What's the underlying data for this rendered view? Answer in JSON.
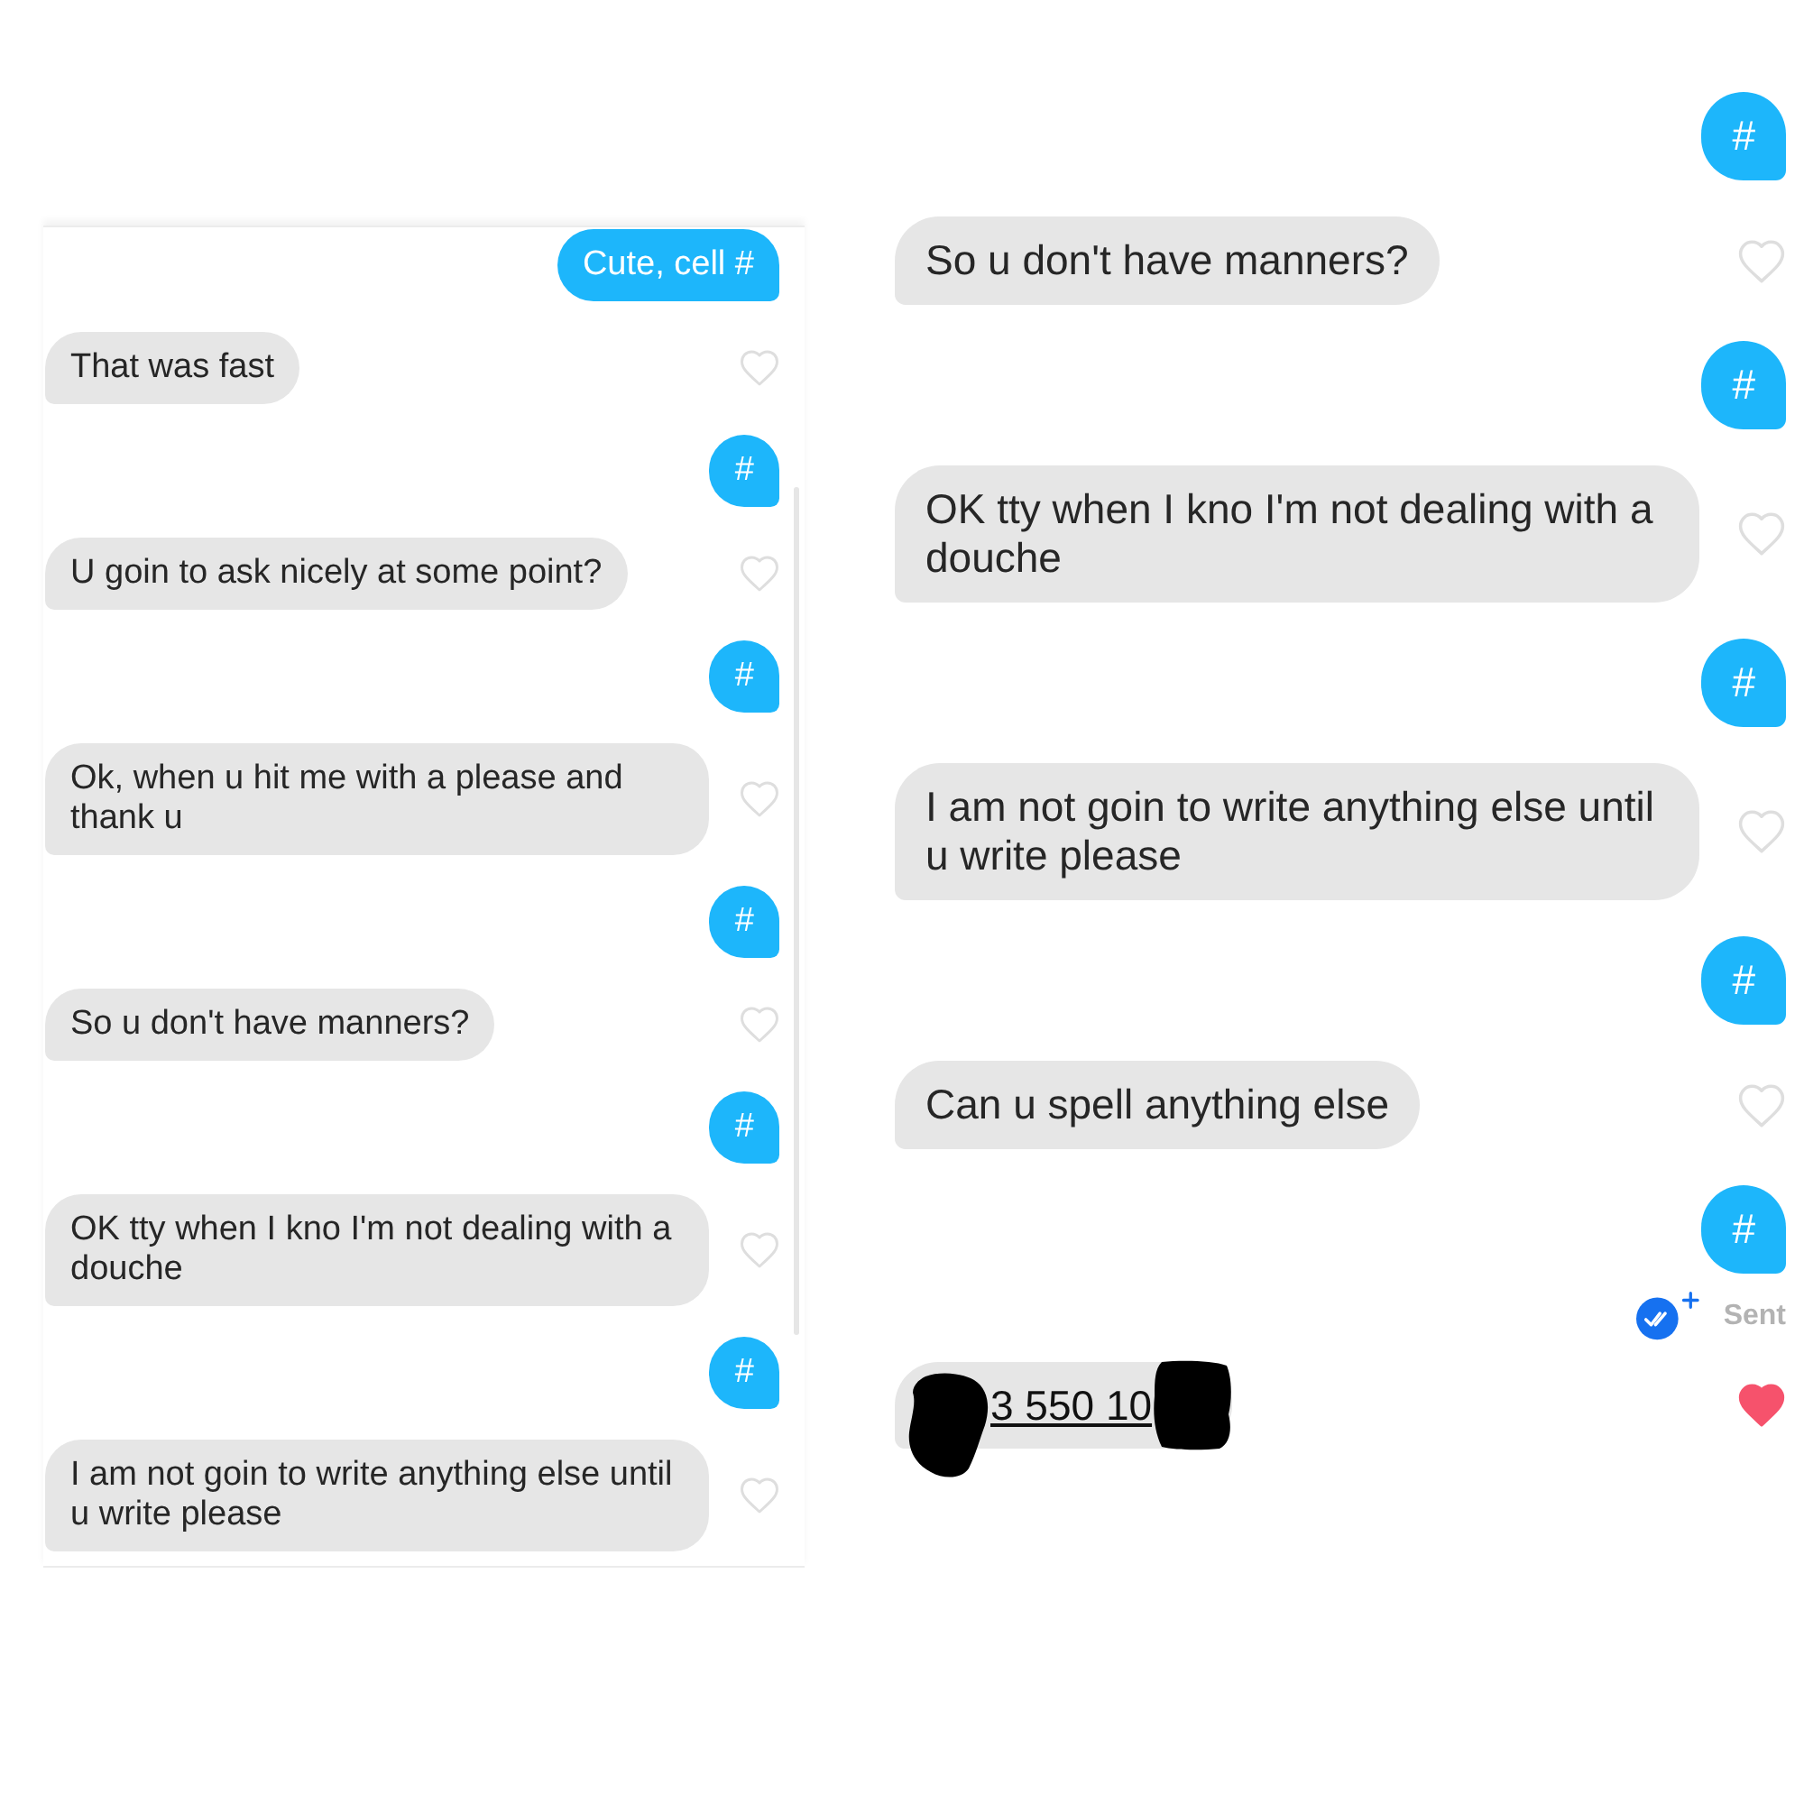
{
  "left_panel": {
    "messages": [
      {
        "kind": "sent",
        "text": "Cute, cell #"
      },
      {
        "kind": "received",
        "text": "That was fast",
        "liked": false
      },
      {
        "kind": "sent",
        "text": "#"
      },
      {
        "kind": "received",
        "text": "U goin to ask nicely at some point?",
        "liked": false
      },
      {
        "kind": "sent",
        "text": "#"
      },
      {
        "kind": "received",
        "text": "Ok, when u hit me with a please and thank u",
        "liked": false
      },
      {
        "kind": "sent",
        "text": "#"
      },
      {
        "kind": "received",
        "text": "So u don't have manners?",
        "liked": false
      },
      {
        "kind": "sent",
        "text": "#"
      },
      {
        "kind": "received",
        "text": "OK tty when I kno I'm not dealing with a douche",
        "liked": false
      },
      {
        "kind": "sent",
        "text": "#"
      },
      {
        "kind": "received",
        "text": "I am not goin to write anything else until u write please",
        "liked": false
      }
    ]
  },
  "right_panel": {
    "messages": [
      {
        "kind": "sent",
        "text": "#"
      },
      {
        "kind": "received",
        "text": "So u don't have manners?",
        "liked": false
      },
      {
        "kind": "sent",
        "text": "#"
      },
      {
        "kind": "received",
        "text": "OK tty when I kno I'm not dealing with a douche",
        "liked": false
      },
      {
        "kind": "sent",
        "text": "#"
      },
      {
        "kind": "received",
        "text": "I am not goin to write anything else until u write please",
        "liked": false
      },
      {
        "kind": "sent",
        "text": "#"
      },
      {
        "kind": "received",
        "text": "Can u spell anything else",
        "liked": false
      },
      {
        "kind": "sent",
        "text": "#"
      },
      {
        "kind": "status",
        "text": "Sent"
      },
      {
        "kind": "redacted_link",
        "text": "3 550 10",
        "liked": true
      }
    ]
  }
}
